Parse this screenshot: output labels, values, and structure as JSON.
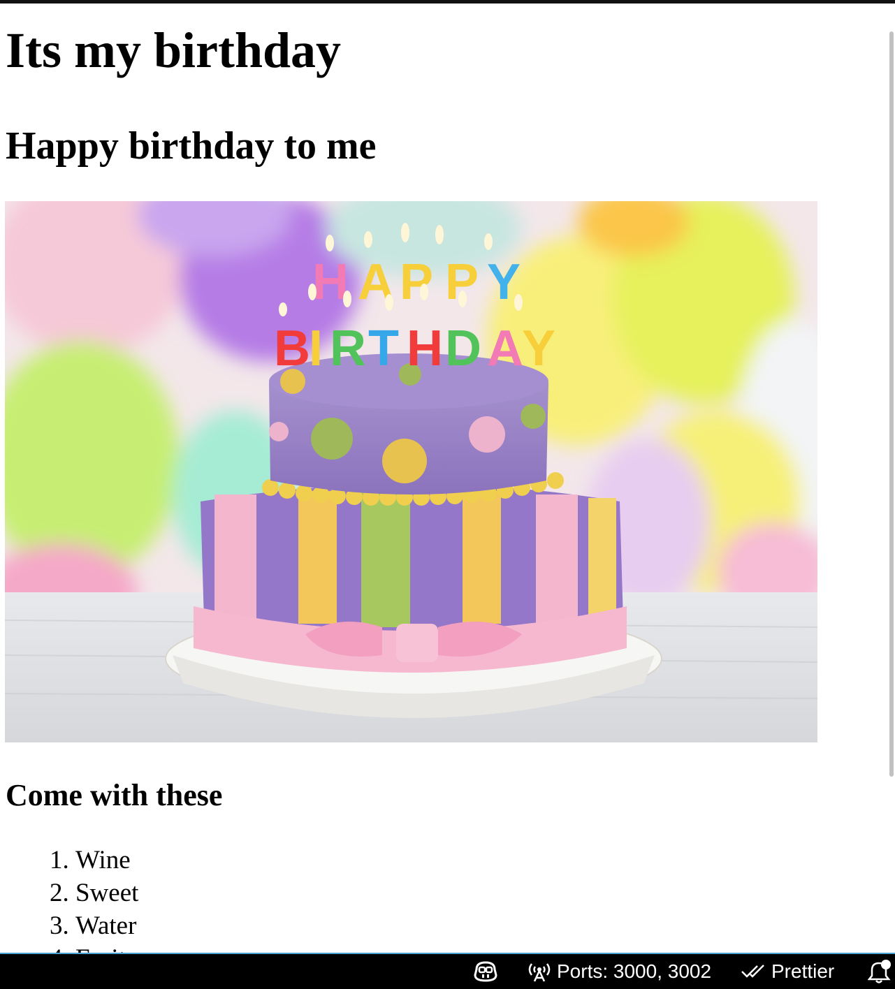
{
  "page": {
    "heading": "Its my birthday",
    "subheading": "Happy birthday to me",
    "image_alt": "birthday cake",
    "list_heading": "Come with these",
    "list_items": [
      "Wine",
      "Sweet",
      "Water",
      "Fruits"
    ]
  },
  "statusbar": {
    "copilot_icon": "copilot-icon",
    "ports_label": "Ports: 3000, 3002",
    "prettier_label": "Prettier",
    "notifications_icon": "bell-icon"
  },
  "colors": {
    "statusbar_bg": "#000000",
    "statusbar_accent": "#4aa3d6",
    "page_bg": "#ffffff"
  }
}
